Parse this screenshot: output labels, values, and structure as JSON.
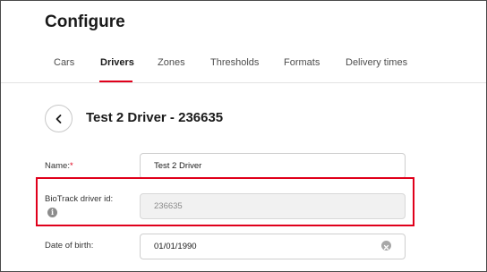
{
  "header": {
    "title": "Configure"
  },
  "tabs": [
    {
      "label": "Cars"
    },
    {
      "label": "Drivers",
      "active": true
    },
    {
      "label": "Zones"
    },
    {
      "label": "Thresholds"
    },
    {
      "label": "Formats"
    },
    {
      "label": "Delivery times"
    }
  ],
  "driver": {
    "title": "Test 2 Driver - 236635"
  },
  "form": {
    "name": {
      "label": "Name:",
      "required_mark": "*",
      "value": "Test 2 Driver"
    },
    "biotrack": {
      "label": "BioTrack driver id:",
      "value": "236635",
      "info_icon": "info-icon"
    },
    "dob": {
      "label": "Date of birth:",
      "value": "01/01/1990"
    }
  },
  "colors": {
    "accent": "#e0001b",
    "highlight_border": "#e0001b"
  },
  "icons": {
    "back": "chevron-left-icon",
    "clear": "clear-icon"
  }
}
